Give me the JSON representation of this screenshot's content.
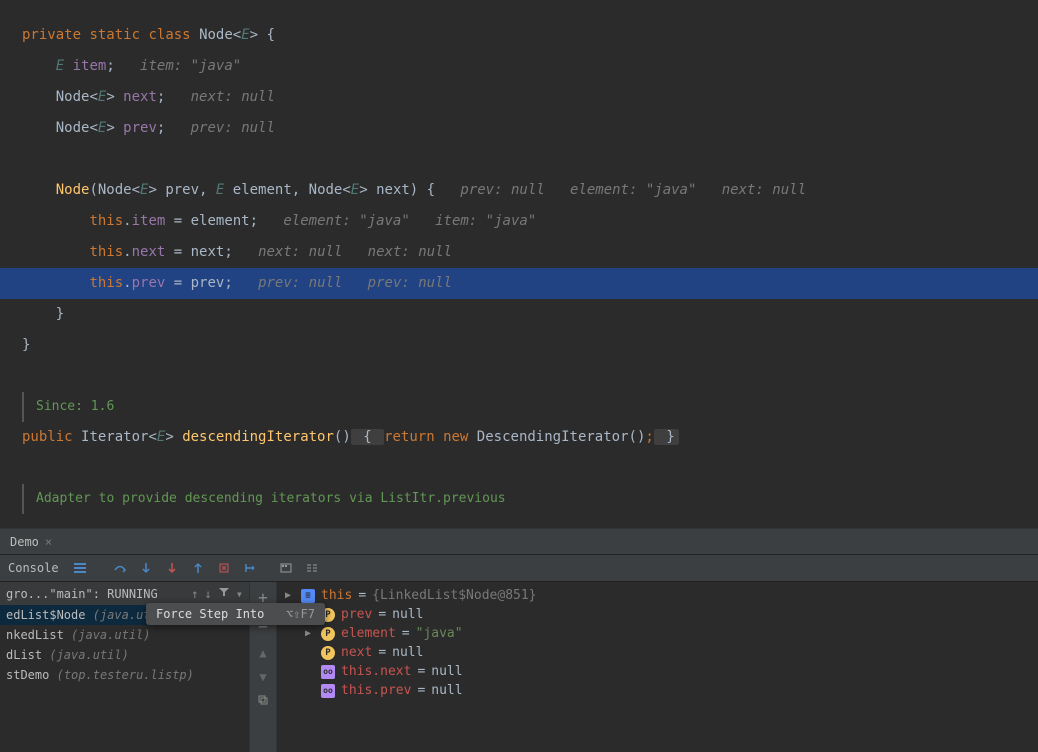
{
  "code": {
    "line1": {
      "kw1": "private",
      "kw2": "static",
      "kw3": "class",
      "name": "Node",
      "gen": "E",
      "brace": " {"
    },
    "line2": {
      "type": "E",
      "fld": "item",
      "semi": ";",
      "hint": "item: \"java\""
    },
    "line3": {
      "cls": "Node",
      "lt": "<",
      "gen": "E",
      "gt": "> ",
      "fld": "next",
      "semi": ";",
      "hint": "next: null"
    },
    "line4": {
      "cls": "Node",
      "lt": "<",
      "gen": "E",
      "gt": "> ",
      "fld": "prev",
      "semi": ";",
      "hint": "prev: null"
    },
    "ctor": {
      "name": "Node",
      "p1": "Node<",
      "p1g": "E",
      "p1e": "> prev",
      "p2": "E",
      "p2n": " element",
      "p3": "Node<",
      "p3g": "E",
      "p3e": "> next) {",
      "h1": "prev: null",
      "h2": "element: \"java\"",
      "h3": "next: null"
    },
    "b1": {
      "this": "this",
      "dot": ".",
      "fld": "item",
      "eq": " = ",
      "rhs": "element",
      "semi": ";",
      "h1": "element: \"java\"",
      "h2": "item: \"java\""
    },
    "b2": {
      "this": "this",
      "dot": ".",
      "fld": "next",
      "eq": " = ",
      "rhs": "next",
      "semi": ";",
      "h1": "next: null",
      "h2": "next: null"
    },
    "b3": {
      "this": "this",
      "dot": ".",
      "fld": "prev",
      "eq": " = ",
      "rhs": "prev",
      "semi": ";",
      "h1": "prev: null",
      "h2": "prev: null"
    },
    "close1": "}",
    "close2": "}",
    "since": "Since: 1.6",
    "iter": {
      "kw1": "public",
      "type": "Iterator",
      "lt": "<",
      "gen": "E",
      "gt": "> ",
      "fn": "descendingIterator",
      "par": "()",
      "brace": " { ",
      "ret": "return",
      "nw": "new",
      "call": " DescendingIterator()",
      "semi": ";",
      "close": " }"
    },
    "adapter": "Adapter to provide descending iterators via ListItr.previous"
  },
  "tabs": {
    "demo": "Demo"
  },
  "toolbar": {
    "console": "Console"
  },
  "tooltip": {
    "text": "Force Step Into",
    "shortcut": "⌥⇧F7"
  },
  "frames": {
    "header": "gro...\"main\": RUNNING",
    "items": [
      {
        "name": "edList$Node",
        "pkg": "(java.util)"
      },
      {
        "name": "nkedList",
        "pkg": "(java.util)"
      },
      {
        "name": "dList",
        "pkg": "(java.util)"
      },
      {
        "name": "stDemo",
        "pkg": "(top.testeru.listp)"
      }
    ]
  },
  "vars": {
    "this": {
      "name": "this",
      "val": "{LinkedList$Node@851}"
    },
    "prev": {
      "name": "prev",
      "val": "null"
    },
    "element": {
      "name": "element",
      "val": "\"java\""
    },
    "next": {
      "name": "next",
      "val": "null"
    },
    "thisnext": {
      "name": "this.next",
      "val": "null"
    },
    "thisprev": {
      "name": "this.prev",
      "val": "null"
    }
  }
}
